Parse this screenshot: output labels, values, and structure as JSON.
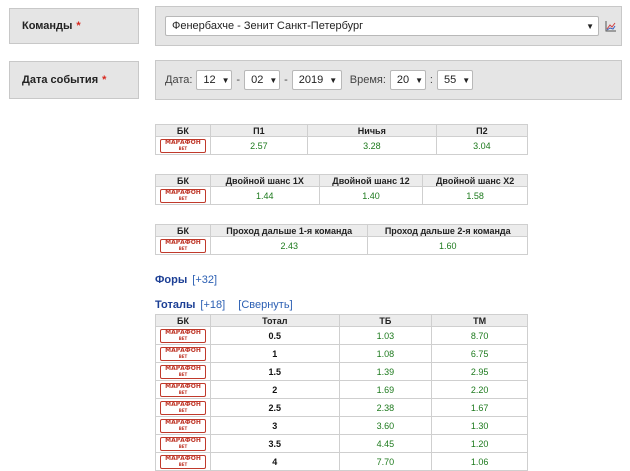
{
  "form": {
    "teams_label": "Команды",
    "required_mark": "*",
    "teams_value": "Фенербахче - Зенит Санкт-Петербург",
    "date_label": "Дата события",
    "date_prefix": "Дата:",
    "day": "12",
    "month": "02",
    "year": "2019",
    "time_prefix": "Время:",
    "hour": "20",
    "minute": "55",
    "dash": "-",
    "colon": ":"
  },
  "bookmaker": {
    "logo_top": "МАРАФОН",
    "logo_bottom": "BET"
  },
  "table_1x2": {
    "headers": [
      "БК",
      "П1",
      "Ничья",
      "П2"
    ],
    "row": [
      "2.57",
      "3.28",
      "3.04"
    ]
  },
  "table_double": {
    "headers": [
      "БК",
      "Двойной шанс 1X",
      "Двойной шанс 12",
      "Двойной шанс X2"
    ],
    "row": [
      "1.44",
      "1.40",
      "1.58"
    ]
  },
  "table_advance": {
    "headers": [
      "БК",
      "Проход дальше 1-я команда",
      "Проход дальше 2-я команда"
    ],
    "row": [
      "2.43",
      "1.60"
    ]
  },
  "handicaps": {
    "title": "Форы",
    "count": "[+32]"
  },
  "totals": {
    "title": "Тоталы",
    "count": "[+18]",
    "collapse": "[Свернуть]",
    "headers": [
      "БК",
      "Тотал",
      "ТБ",
      "ТМ"
    ],
    "rows": [
      [
        "0.5",
        "1.03",
        "8.70"
      ],
      [
        "1",
        "1.08",
        "6.75"
      ],
      [
        "1.5",
        "1.39",
        "2.95"
      ],
      [
        "2",
        "1.69",
        "2.20"
      ],
      [
        "2.5",
        "2.38",
        "1.67"
      ],
      [
        "3",
        "3.60",
        "1.30"
      ],
      [
        "3.5",
        "4.45",
        "1.20"
      ],
      [
        "4",
        "7.70",
        "1.06"
      ]
    ]
  },
  "colors": {
    "odds_green": "#1d7a1d",
    "required_red": "#d8271d",
    "link_blue": "#1c3f95"
  }
}
